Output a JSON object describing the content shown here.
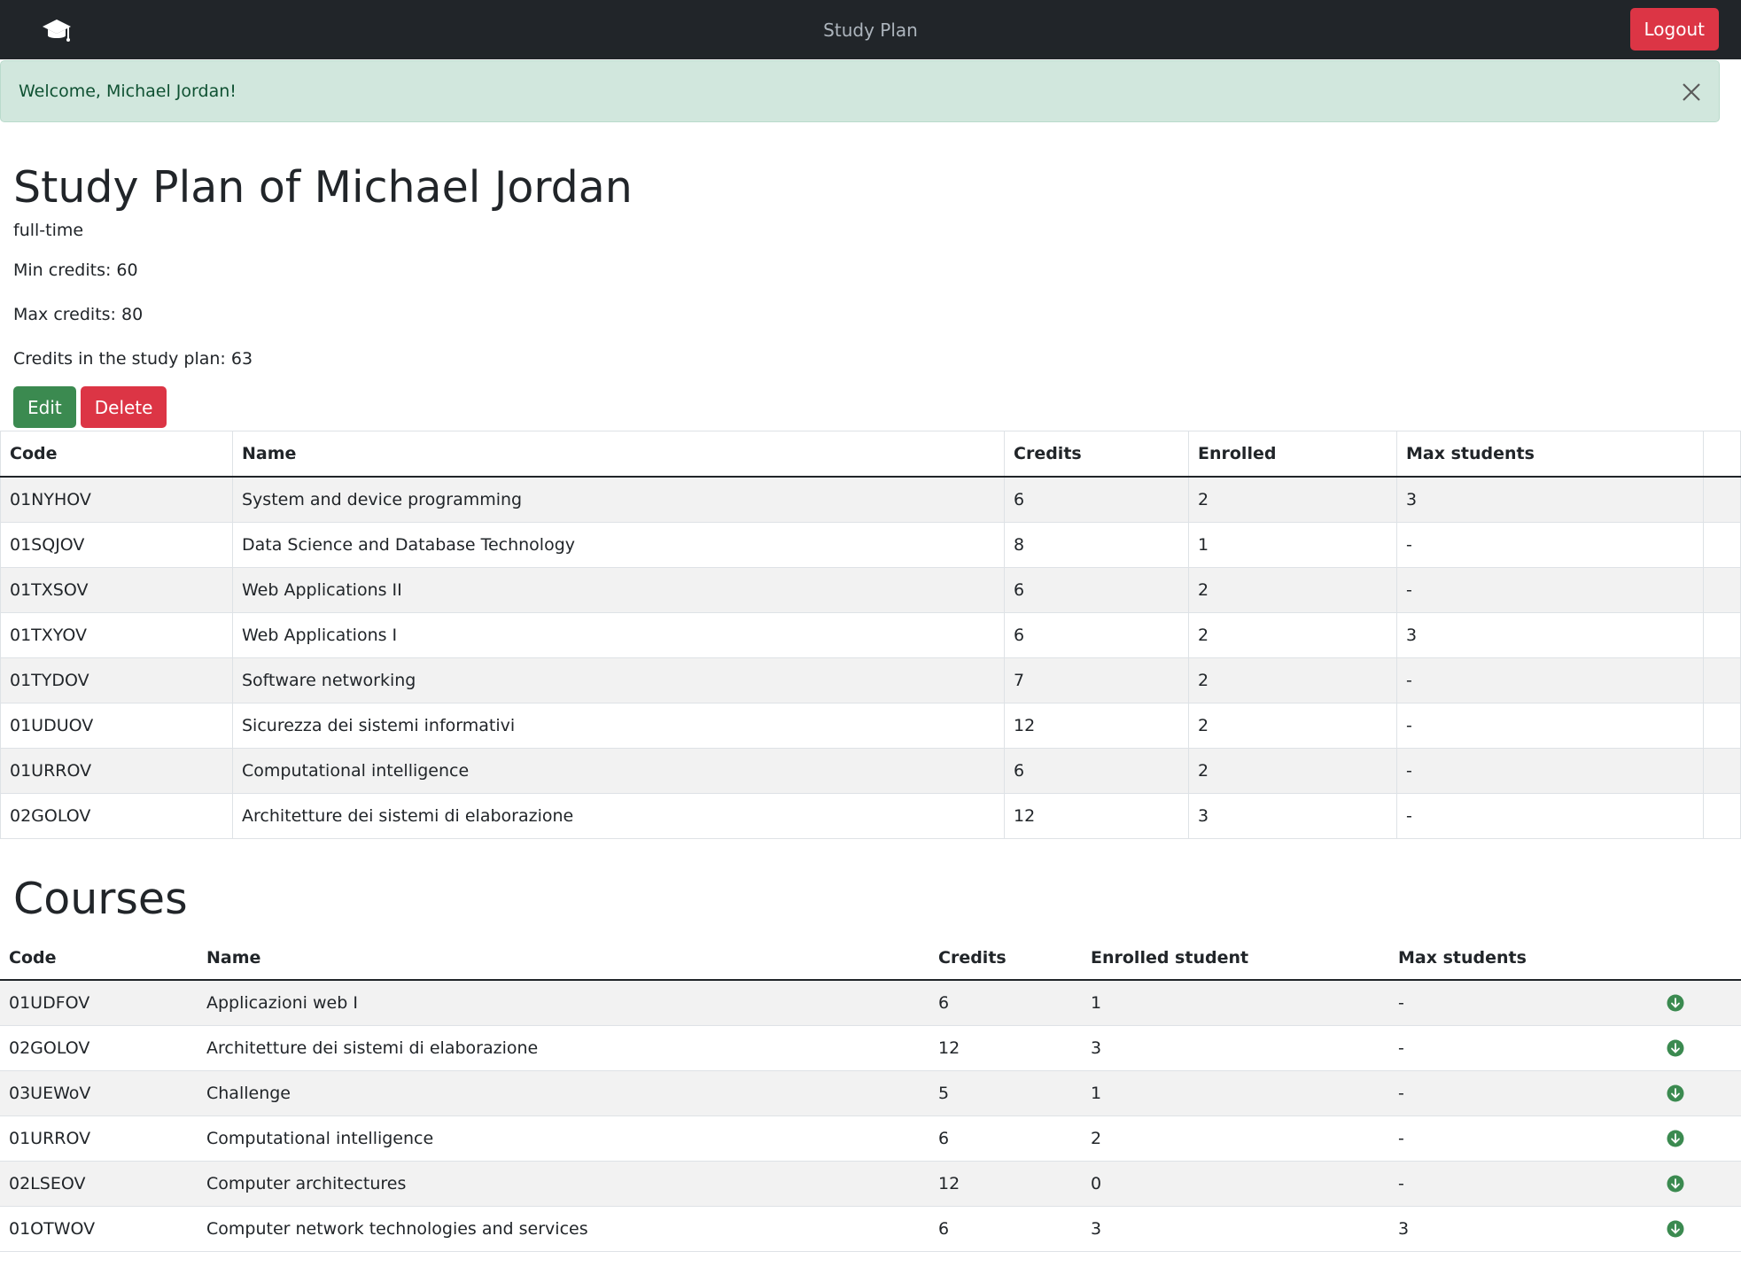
{
  "navbar": {
    "title": "Study Plan",
    "logout_label": "Logout",
    "brand_icon": "graduation-cap-icon"
  },
  "alert": {
    "message": "Welcome, Michael Jordan!",
    "close_icon": "close-icon"
  },
  "study_plan": {
    "title": "Study Plan of Michael Jordan",
    "type": "full-time",
    "min_credits": "Min credits: 60",
    "max_credits": "Max credits: 80",
    "credits_in_plan": "Credits in the study plan: 63",
    "edit_label": "Edit",
    "delete_label": "Delete",
    "headers": [
      "Code",
      "Name",
      "Credits",
      "Enrolled",
      "Max students"
    ],
    "rows": [
      [
        "01NYHOV",
        "System and device programming",
        "6",
        "2",
        "3"
      ],
      [
        "01SQJOV",
        "Data Science and Database Technology",
        "8",
        "1",
        "-"
      ],
      [
        "01TXSOV",
        "Web Applications II",
        "6",
        "2",
        "-"
      ],
      [
        "01TXYOV",
        "Web Applications I",
        "6",
        "2",
        "3"
      ],
      [
        "01TYDOV",
        "Software networking",
        "7",
        "2",
        "-"
      ],
      [
        "01UDUOV",
        "Sicurezza dei sistemi informativi",
        "12",
        "2",
        "-"
      ],
      [
        "01URROV",
        "Computational intelligence",
        "6",
        "2",
        "-"
      ],
      [
        "02GOLOV",
        "Architetture dei sistemi di elaborazione",
        "12",
        "3",
        "-"
      ]
    ]
  },
  "courses": {
    "title": "Courses",
    "headers": [
      "Code",
      "Name",
      "Credits",
      "Enrolled student",
      "Max students"
    ],
    "row_action_icon": "expand-down-icon",
    "rows": [
      [
        "01UDFOV",
        "Applicazioni web I",
        "6",
        "1",
        "-"
      ],
      [
        "02GOLOV",
        "Architetture dei sistemi di elaborazione",
        "12",
        "3",
        "-"
      ],
      [
        "03UEWoV",
        "Challenge",
        "5",
        "1",
        "-"
      ],
      [
        "01URROV",
        "Computational intelligence",
        "6",
        "2",
        "-"
      ],
      [
        "02LSEOV",
        "Computer architectures",
        "12",
        "0",
        "-"
      ],
      [
        "01OTWOV",
        "Computer network technologies and services",
        "6",
        "3",
        "3"
      ]
    ]
  },
  "colors": {
    "navbar_bg": "#212529",
    "danger": "#dc3545",
    "success": "#3b8a50",
    "alert_bg": "#d1e7dd",
    "icon_green": "#3b8a50"
  }
}
